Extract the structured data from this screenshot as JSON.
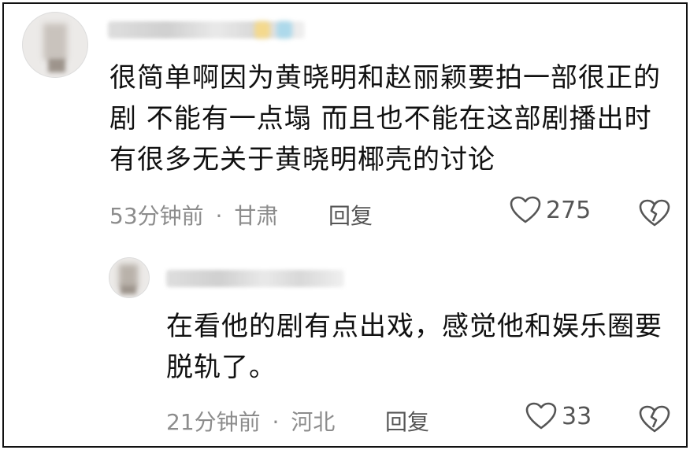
{
  "comments": [
    {
      "text": "很简单啊因为黄晓明和赵丽颖要拍一部很正的剧 不能有一点塌 而且也不能在这部剧播出时有很多无关于黄晓明椰壳的讨论",
      "time": "53分钟前",
      "location": "甘肃",
      "reply_label": "回复",
      "likes": "275",
      "avatar_icon": "user-avatar-icon",
      "like_icon": "heart-outline-icon",
      "dislike_icon": "broken-heart-icon"
    },
    {
      "text": "在看他的剧有点出戏，感觉他和娱乐圈要脱轨了。",
      "time": "21分钟前",
      "location": "河北",
      "reply_label": "回复",
      "likes": "33",
      "avatar_icon": "user-avatar-icon",
      "like_icon": "heart-outline-icon",
      "dislike_icon": "broken-heart-icon"
    }
  ],
  "separator": "·",
  "colors": {
    "text": "#111111",
    "meta": "#8c8c8c",
    "action": "#555555"
  }
}
